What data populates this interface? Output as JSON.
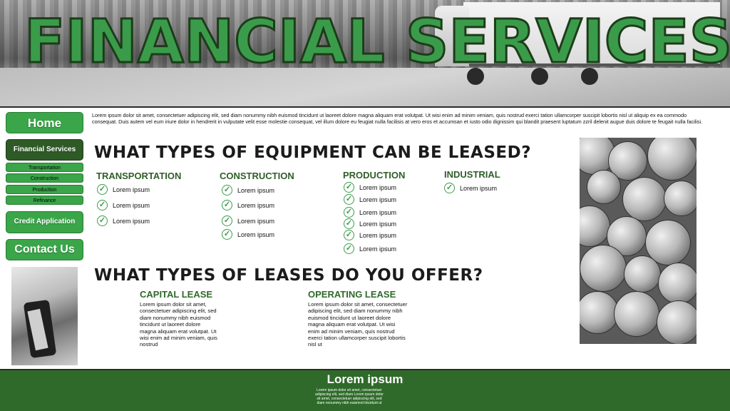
{
  "header": {
    "title": "FINANCIAL SERVICES"
  },
  "nav": {
    "home": "Home",
    "financial_services": "Financial Services",
    "sub_items": [
      "Transportation",
      "Construction",
      "Production",
      "Refinance"
    ],
    "credit_application": "Credit Application",
    "contact_us": "Contact Us"
  },
  "intro": "Lorem ipsum dolor sit amet, consectetuer adipiscing elit, sed diam nonummy nibh euismod tincidunt ut laoreet dolore magna aliquam erat volutpat. Ut wisi enim ad minim veniam, quis nostrud exerci tation ullamcorper suscipit lobortis nisl ut aliquip ex ea commodo consequat. Duis autem vel eum iriure dolor in hendrerit in vulputate velit esse molestie consequat, vel illum dolore eu feugiat nulla facilisis at vero eros et accumsan et iusto odio dignissim qui blandit praesent luptatum zzril delenit augue duis dolore te feugait nulla facilisi.",
  "equipment": {
    "heading": "WHAT TYPES OF EQUIPMENT CAN BE LEASED?",
    "categories": [
      {
        "name": "TRANSPORTATION",
        "items": [
          "Lorem ipsum",
          "Lorem ipsum",
          "Lorem ipsum"
        ]
      },
      {
        "name": "CONSTRUCTION",
        "items": [
          "Lorem ipsum",
          "Lorem ipsum",
          "Lorem ipsum",
          "Lorem ipsum"
        ]
      },
      {
        "name": "PRODUCTION",
        "items": [
          "Lorem ipsum",
          "Lorem ipsum",
          "Lorem ipsum",
          "Lorem ipsum",
          "Lorem ipsum",
          "Lorem ipsum"
        ]
      },
      {
        "name": "INDUSTRIAL",
        "items": [
          "Lorem ipsum"
        ]
      }
    ]
  },
  "leases": {
    "heading": "WHAT TYPES OF LEASES DO YOU OFFER?",
    "capital": {
      "title": "CAPITAL LEASE",
      "body": "Lorem ipsum dolor sit amet, consectetuer adipiscing elit, sed diam nonummy nibh euismod tincidunt ut laoreet dolore magna aliquam erat volutpat. Ut wisi enim ad minim veniam, quis nostrud"
    },
    "operating": {
      "title": "OPERATING LEASE",
      "body": "Lorem ipsum dolor sit amet, consectetuer adipiscing elit, sed diam nonummy nibh euismod tincidunt ut laoreet dolore magna aliquam erat volutpat. Ut wisi enim ad minim veniam, quis nostrud exerci tation ullamcorper suscipit lobortis nisl ut"
    }
  },
  "footer": {
    "title": "Lorem ipsum",
    "text": "Lorem ipsum dolor sit amet, consectetuer adipiscing elit, sed diam Lorem ipsum dolor sit amet, consectetuer adipiscing elit, sed diam nonummy nibh euismod tincidunt ut"
  },
  "colors": {
    "accent": "#3aa549",
    "dark_green": "#2f6a2a",
    "heading_green": "#2f5e28"
  },
  "icons": {
    "check": "check-circle-icon"
  }
}
